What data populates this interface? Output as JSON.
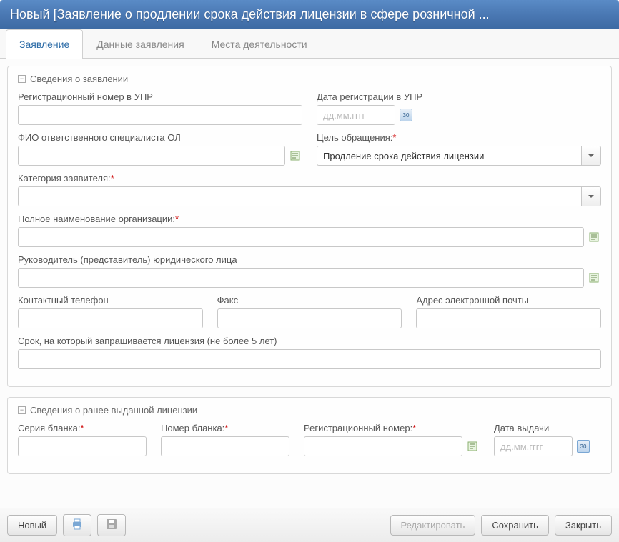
{
  "window": {
    "title": "Новый [Заявление о продлении срока действия лицензии в сфере розничной ..."
  },
  "tabs": [
    {
      "label": "Заявление",
      "active": true
    },
    {
      "label": "Данные заявления",
      "active": false
    },
    {
      "label": "Места деятельности",
      "active": false
    }
  ],
  "section1": {
    "legend": "Сведения о заявлении",
    "reg_num_label": "Регистрационный номер в УПР",
    "reg_num_value": "",
    "reg_date_label": "Дата регистрации в УПР",
    "reg_date_placeholder": "дд.мм.гггг",
    "reg_date_value": "",
    "fio_label": "ФИО ответственного специалиста ОЛ",
    "fio_value": "",
    "purpose_label": "Цель обращения:",
    "purpose_value": "Продление срока действия лицензии",
    "category_label": "Категория заявителя:",
    "category_value": "",
    "org_label": "Полное наименование организации:",
    "org_value": "",
    "head_label": "Руководитель (представитель) юридического лица",
    "head_value": "",
    "phone_label": "Контактный телефон",
    "phone_value": "",
    "fax_label": "Факс",
    "fax_value": "",
    "email_label": "Адрес электронной почты",
    "email_value": "",
    "term_label": "Срок, на который запрашивается лицензия (не более 5 лет)",
    "term_value": ""
  },
  "section2": {
    "legend": "Сведения о ранее выданной лицензии",
    "series_label": "Серия бланка:",
    "series_value": "",
    "number_label": "Номер бланка:",
    "number_value": "",
    "regnum_label": "Регистрационный номер:",
    "regnum_value": "",
    "issue_date_label": "Дата выдачи",
    "issue_date_placeholder": "дд.мм.гггг",
    "issue_date_value": ""
  },
  "footer": {
    "new_btn": "Новый",
    "edit_btn": "Редактировать",
    "save_btn": "Сохранить",
    "close_btn": "Закрыть"
  },
  "icons": {
    "calendar_text": "30"
  }
}
